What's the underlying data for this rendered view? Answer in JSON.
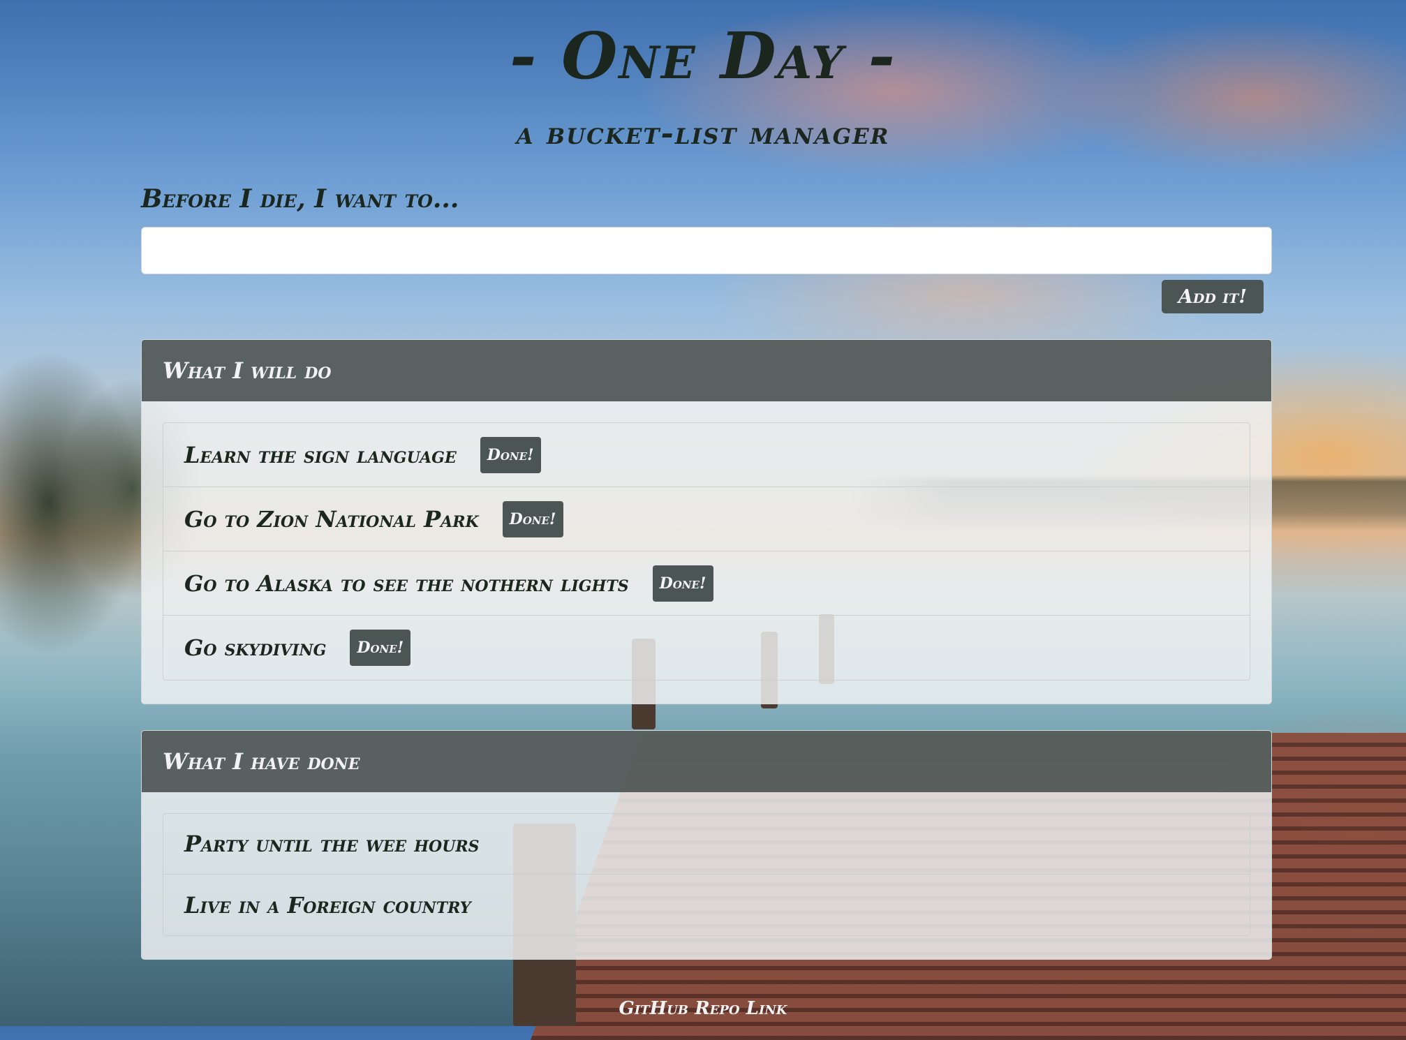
{
  "header": {
    "title": "- One Day -",
    "subtitle": "a bucket-list manager"
  },
  "form": {
    "label": "Before I die, I want to...",
    "input_value": "",
    "input_placeholder": "",
    "add_button_label": "Add it!"
  },
  "todo_panel": {
    "heading": "What I will do",
    "done_button_label": "Done!",
    "items": [
      {
        "text": "Learn the sign language"
      },
      {
        "text": "Go to Zion National Park"
      },
      {
        "text": "Go to Alaska to see the nothern lights"
      },
      {
        "text": "Go skydiving"
      }
    ]
  },
  "done_panel": {
    "heading": "What I have done",
    "items": [
      {
        "text": "Party until the wee hours"
      },
      {
        "text": "Live in a Foreign country"
      }
    ]
  },
  "footer": {
    "link_text": "GitHub Repo Link"
  }
}
